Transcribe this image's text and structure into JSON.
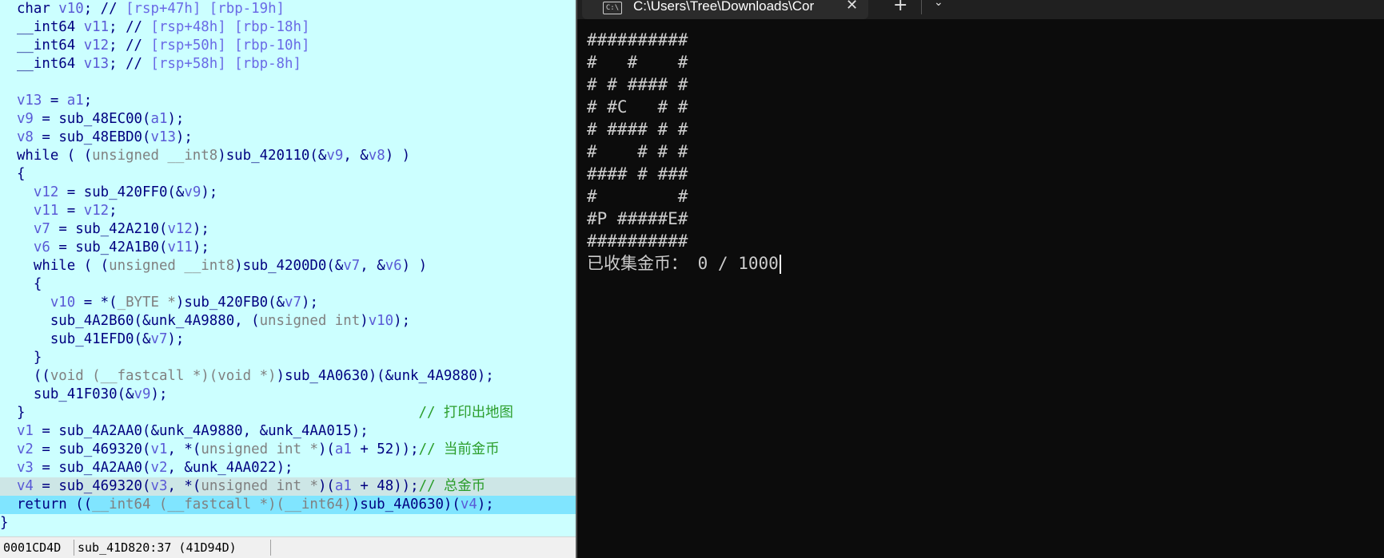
{
  "ida": {
    "lines": [
      [
        {
          "t": "  char ",
          "c": "kw"
        },
        {
          "t": "v10",
          "c": "var"
        },
        {
          "t": "; // ",
          "c": "kw"
        },
        {
          "t": "[rsp+47h] [rbp-19h]",
          "c": "rsp"
        }
      ],
      [
        {
          "t": "  __int64 ",
          "c": "kw"
        },
        {
          "t": "v11",
          "c": "var"
        },
        {
          "t": "; // ",
          "c": "kw"
        },
        {
          "t": "[rsp+48h] [rbp-18h]",
          "c": "rsp"
        }
      ],
      [
        {
          "t": "  __int64 ",
          "c": "kw"
        },
        {
          "t": "v12",
          "c": "var"
        },
        {
          "t": "; // ",
          "c": "kw"
        },
        {
          "t": "[rsp+50h] [rbp-10h]",
          "c": "rsp"
        }
      ],
      [
        {
          "t": "  __int64 ",
          "c": "kw"
        },
        {
          "t": "v13",
          "c": "var"
        },
        {
          "t": "; // ",
          "c": "kw"
        },
        {
          "t": "[rsp+58h] [rbp-8h]",
          "c": "rsp"
        }
      ],
      [],
      [
        {
          "t": "  ",
          "c": "kw"
        },
        {
          "t": "v13",
          "c": "var"
        },
        {
          "t": " = ",
          "c": "kw"
        },
        {
          "t": "a1",
          "c": "var"
        },
        {
          "t": ";",
          "c": "kw"
        }
      ],
      [
        {
          "t": "  ",
          "c": "kw"
        },
        {
          "t": "v9",
          "c": "var"
        },
        {
          "t": " = sub_48EC00(",
          "c": "fn"
        },
        {
          "t": "a1",
          "c": "var"
        },
        {
          "t": ");",
          "c": "kw"
        }
      ],
      [
        {
          "t": "  ",
          "c": "kw"
        },
        {
          "t": "v8",
          "c": "var"
        },
        {
          "t": " = sub_48EBD0(",
          "c": "fn"
        },
        {
          "t": "v13",
          "c": "var"
        },
        {
          "t": ");",
          "c": "kw"
        }
      ],
      [
        {
          "t": "  while ( (",
          "c": "kw"
        },
        {
          "t": "unsigned __int8",
          "c": "type"
        },
        {
          "t": ")sub_420110(&",
          "c": "fn"
        },
        {
          "t": "v9",
          "c": "var"
        },
        {
          "t": ", &",
          "c": "kw"
        },
        {
          "t": "v8",
          "c": "var"
        },
        {
          "t": ") )",
          "c": "kw"
        }
      ],
      [
        {
          "t": "  {",
          "c": "kw"
        }
      ],
      [
        {
          "t": "    ",
          "c": "kw"
        },
        {
          "t": "v12",
          "c": "var"
        },
        {
          "t": " = sub_420FF0(&",
          "c": "fn"
        },
        {
          "t": "v9",
          "c": "var"
        },
        {
          "t": ");",
          "c": "kw"
        }
      ],
      [
        {
          "t": "    ",
          "c": "kw"
        },
        {
          "t": "v11",
          "c": "var"
        },
        {
          "t": " = ",
          "c": "kw"
        },
        {
          "t": "v12",
          "c": "var"
        },
        {
          "t": ";",
          "c": "kw"
        }
      ],
      [
        {
          "t": "    ",
          "c": "kw"
        },
        {
          "t": "v7",
          "c": "var"
        },
        {
          "t": " = sub_42A210(",
          "c": "fn"
        },
        {
          "t": "v12",
          "c": "var"
        },
        {
          "t": ");",
          "c": "kw"
        }
      ],
      [
        {
          "t": "    ",
          "c": "kw"
        },
        {
          "t": "v6",
          "c": "var"
        },
        {
          "t": " = sub_42A1B0(",
          "c": "fn"
        },
        {
          "t": "v11",
          "c": "var"
        },
        {
          "t": ");",
          "c": "kw"
        }
      ],
      [
        {
          "t": "    while ( (",
          "c": "kw"
        },
        {
          "t": "unsigned __int8",
          "c": "type"
        },
        {
          "t": ")sub_4200D0(&",
          "c": "fn"
        },
        {
          "t": "v7",
          "c": "var"
        },
        {
          "t": ", &",
          "c": "kw"
        },
        {
          "t": "v6",
          "c": "var"
        },
        {
          "t": ") )",
          "c": "kw"
        }
      ],
      [
        {
          "t": "    {",
          "c": "kw"
        }
      ],
      [
        {
          "t": "      ",
          "c": "kw"
        },
        {
          "t": "v10",
          "c": "var"
        },
        {
          "t": " = *(",
          "c": "kw"
        },
        {
          "t": "_BYTE *",
          "c": "type"
        },
        {
          "t": ")sub_420FB0(&",
          "c": "fn"
        },
        {
          "t": "v7",
          "c": "var"
        },
        {
          "t": ");",
          "c": "kw"
        }
      ],
      [
        {
          "t": "      sub_4A2B60(&unk_4A9880, (",
          "c": "fn"
        },
        {
          "t": "unsigned int",
          "c": "type"
        },
        {
          "t": ")",
          "c": "kw"
        },
        {
          "t": "v10",
          "c": "var"
        },
        {
          "t": ");",
          "c": "kw"
        }
      ],
      [
        {
          "t": "      sub_41EFD0(&",
          "c": "fn"
        },
        {
          "t": "v7",
          "c": "var"
        },
        {
          "t": ");",
          "c": "kw"
        }
      ],
      [
        {
          "t": "    }",
          "c": "kw"
        }
      ],
      [
        {
          "t": "    ((",
          "c": "kw"
        },
        {
          "t": "void (__fastcall *)(void *)",
          "c": "type"
        },
        {
          "t": ")sub_4A0630)(&unk_4A9880);",
          "c": "fn"
        }
      ],
      [
        {
          "t": "    sub_41F030(&",
          "c": "fn"
        },
        {
          "t": "v9",
          "c": "var"
        },
        {
          "t": ");",
          "c": "kw"
        }
      ],
      [
        {
          "t": "  }",
          "c": "kw"
        },
        {
          "t": "                                               // 打印出地图",
          "c": "cmt"
        }
      ],
      [
        {
          "t": "  ",
          "c": "kw"
        },
        {
          "t": "v1",
          "c": "var"
        },
        {
          "t": " = sub_4A2AA0(&unk_4A9880, &unk_4AA015);",
          "c": "fn"
        }
      ],
      [
        {
          "t": "  ",
          "c": "kw"
        },
        {
          "t": "v2",
          "c": "var"
        },
        {
          "t": " = sub_469320(",
          "c": "fn"
        },
        {
          "t": "v1",
          "c": "var"
        },
        {
          "t": ", *(",
          "c": "kw"
        },
        {
          "t": "unsigned int *",
          "c": "type"
        },
        {
          "t": ")(",
          "c": "kw"
        },
        {
          "t": "a1",
          "c": "var"
        },
        {
          "t": " + 52));",
          "c": "kw"
        },
        {
          "t": "// 当前金币",
          "c": "cmt"
        }
      ],
      [
        {
          "t": "  ",
          "c": "kw"
        },
        {
          "t": "v3",
          "c": "var"
        },
        {
          "t": " = sub_4A2AA0(",
          "c": "fn"
        },
        {
          "t": "v2",
          "c": "var"
        },
        {
          "t": ", &unk_4AA022);",
          "c": "kw"
        }
      ],
      [
        {
          "t": "  ",
          "c": "kw"
        },
        {
          "t": "v4",
          "c": "var"
        },
        {
          "t": " = sub_469320(",
          "c": "fn"
        },
        {
          "t": "v3",
          "c": "var"
        },
        {
          "t": ", *(",
          "c": "kw"
        },
        {
          "t": "unsigned int *",
          "c": "type"
        },
        {
          "t": ")(",
          "c": "kw"
        },
        {
          "t": "a1",
          "c": "var"
        },
        {
          "t": " + 48));",
          "c": "kw"
        },
        {
          "t": "// 总金币",
          "c": "cmt"
        }
      ],
      [
        {
          "t": "  return ((",
          "c": "kw"
        },
        {
          "t": "__int64 (__fastcall *)(__int64)",
          "c": "type"
        },
        {
          "t": ")sub_4A0630)(",
          "c": "fn"
        },
        {
          "t": "v4",
          "c": "var"
        },
        {
          "t": ");",
          "c": "kw"
        }
      ],
      [
        {
          "t": "}",
          "c": "kw"
        }
      ]
    ],
    "highlight_gray_line": 26,
    "highlight_cyan_line": 27,
    "status": {
      "offset": "0001CD4D",
      "location": "sub_41D820:37 (41D94D)"
    }
  },
  "terminal": {
    "tab_title": "C:\\Users\\Tree\\Downloads\\Cor",
    "tab_icon_text": "C:\\",
    "close_symbol": "✕",
    "new_tab_symbol": "+",
    "dropdown_symbol": "⌄",
    "output_lines": [
      "##########",
      "#   #    #",
      "# # #### #",
      "# #C   # #",
      "# #### # #",
      "#    # # #",
      "#### # ###",
      "#        #",
      "#P #####E#",
      "##########",
      "已收集金币： 0 / 1000"
    ]
  }
}
